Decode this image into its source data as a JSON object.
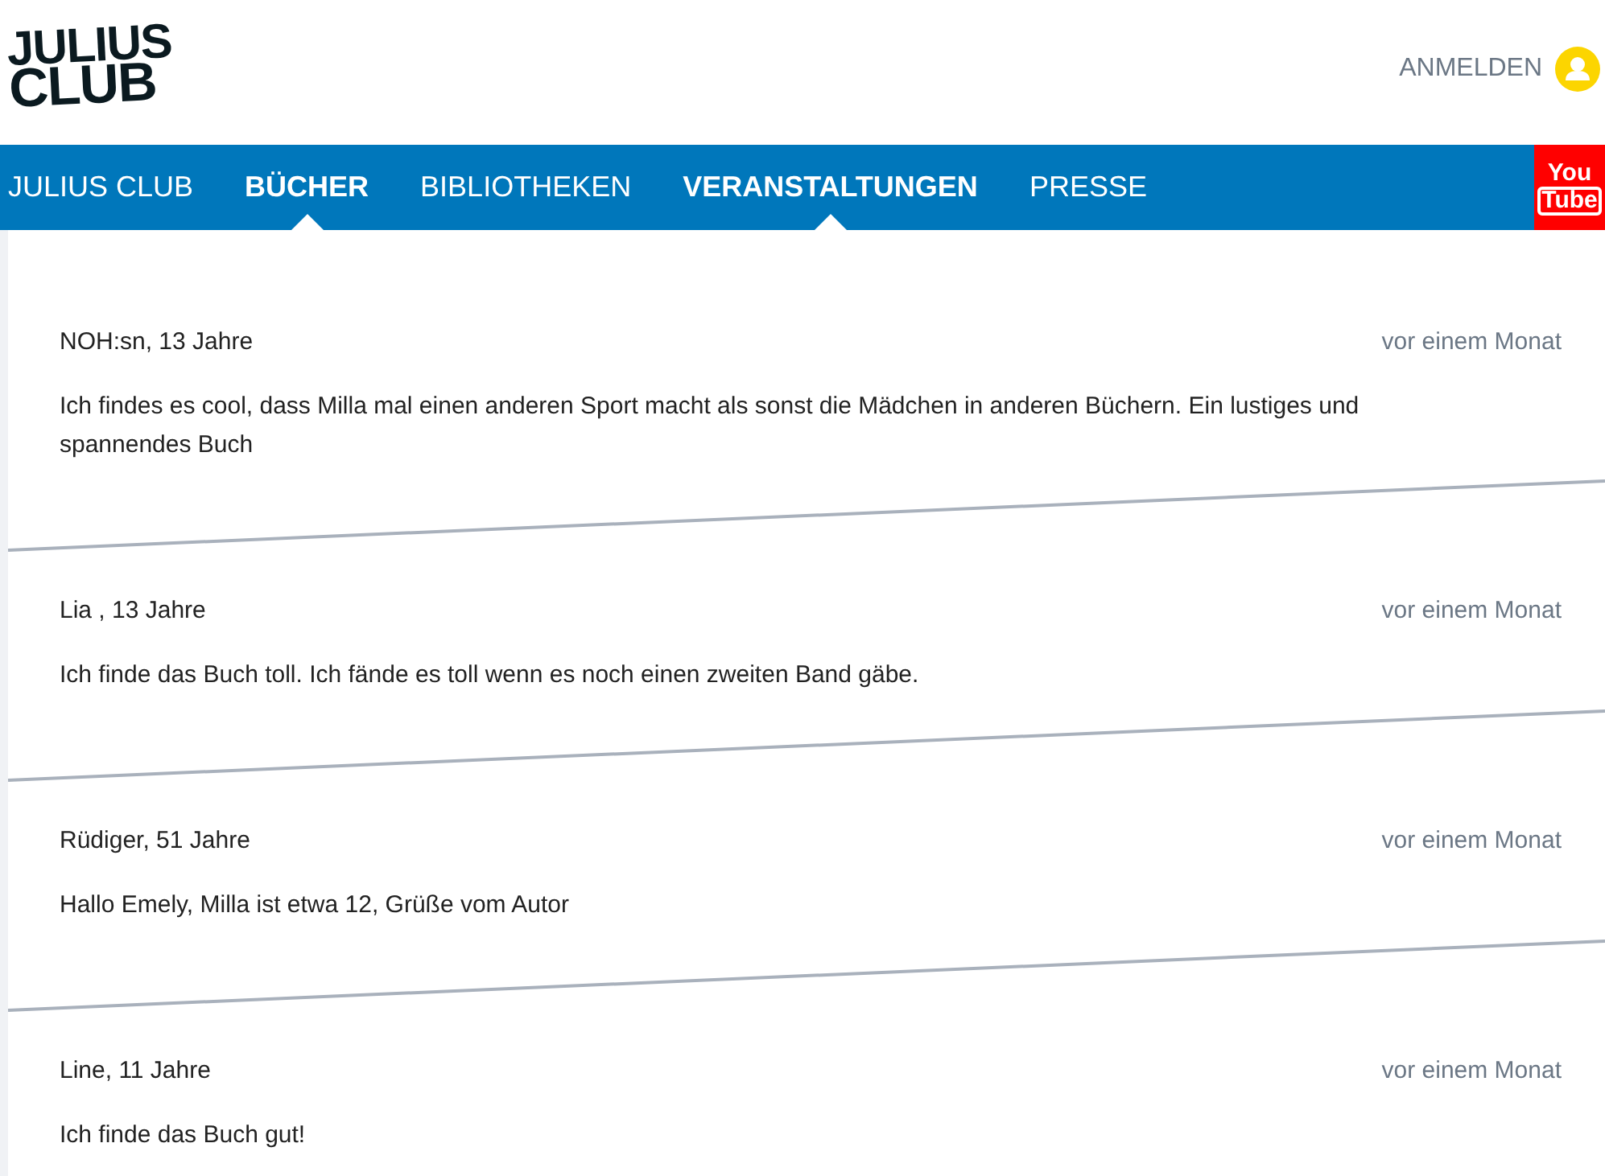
{
  "logo": {
    "line_1": "JULIUS",
    "line_2": "CLUB"
  },
  "login": {
    "label": "ANMELDEN"
  },
  "nav": [
    {
      "label": "JULIUS CLUB",
      "selected": false
    },
    {
      "label": "BÜCHER",
      "selected": true
    },
    {
      "label": "BIBLIOTHEKEN",
      "selected": false
    },
    {
      "label": "VERANSTALTUNGEN",
      "selected": true
    },
    {
      "label": "PRESSE",
      "selected": false
    }
  ],
  "youtube": {
    "line_1": "You",
    "line_2": "Tube"
  },
  "comments": [
    {
      "author": "NOH:sn, 13 Jahre",
      "time": "vor einem Monat",
      "text": "Ich findes es cool, dass Milla mal einen anderen Sport macht als sonst die Mädchen in anderen Büchern. Ein lustiges und spannendes Buch"
    },
    {
      "author": "Lia , 13 Jahre",
      "time": "vor einem Monat",
      "text": "Ich finde das Buch toll. Ich fände es toll wenn es noch einen zweiten Band gäbe."
    },
    {
      "author": "Rüdiger, 51 Jahre",
      "time": "vor einem Monat",
      "text": "Hallo Emely, Milla ist etwa 12, Grüße vom Autor"
    },
    {
      "author": "Line, 11 Jahre",
      "time": "vor einem Monat",
      "text": "Ich finde das Buch gut!"
    }
  ]
}
